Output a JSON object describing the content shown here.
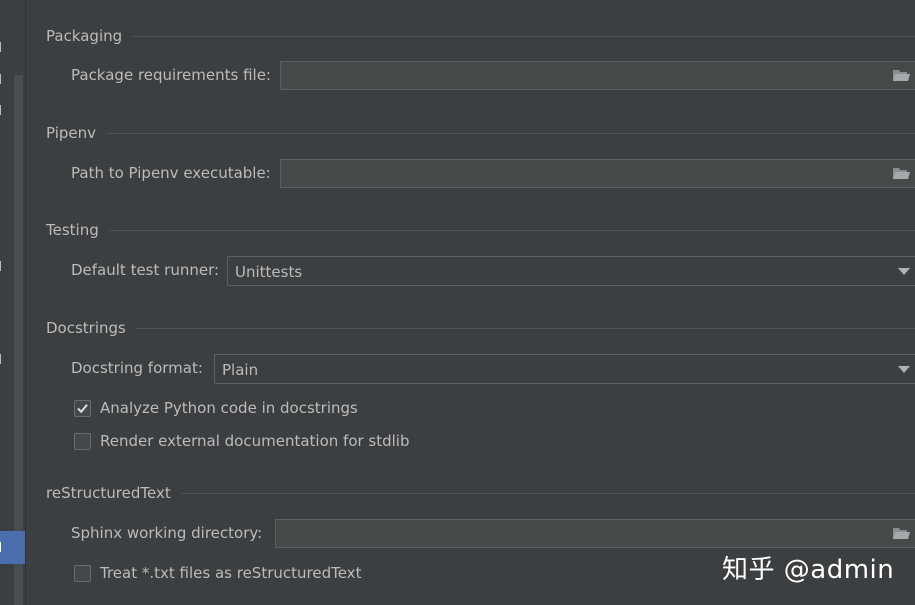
{
  "sections": {
    "packaging": {
      "title": "Packaging",
      "requirements_label": "Package requirements file:",
      "requirements_value": ""
    },
    "pipenv": {
      "title": "Pipenv",
      "path_label": "Path to Pipenv executable:",
      "path_value": ""
    },
    "testing": {
      "title": "Testing",
      "runner_label": "Default test runner:",
      "runner_value": "Unittests"
    },
    "docstrings": {
      "title": "Docstrings",
      "format_label": "Docstring format:",
      "format_value": "Plain",
      "analyze_label": "Analyze Python code in docstrings",
      "analyze_checked": true,
      "render_label": "Render external documentation for stdlib",
      "render_checked": false
    },
    "restructuredtext": {
      "title": "reStructuredText",
      "sphinx_label": "Sphinx working directory:",
      "sphinx_value": "",
      "treat_label": "Treat *.txt files as reStructuredText",
      "treat_checked": false
    }
  },
  "watermark": "知乎 @admin",
  "icons": {
    "folder": "folder-icon",
    "dropdown": "chevron-down-icon",
    "checkmark": "checkmark-icon"
  },
  "colors": {
    "background": "#3c3f41",
    "text": "#bbbbbb",
    "field_bg": "#45494a",
    "selection": "#4b6eaf"
  }
}
